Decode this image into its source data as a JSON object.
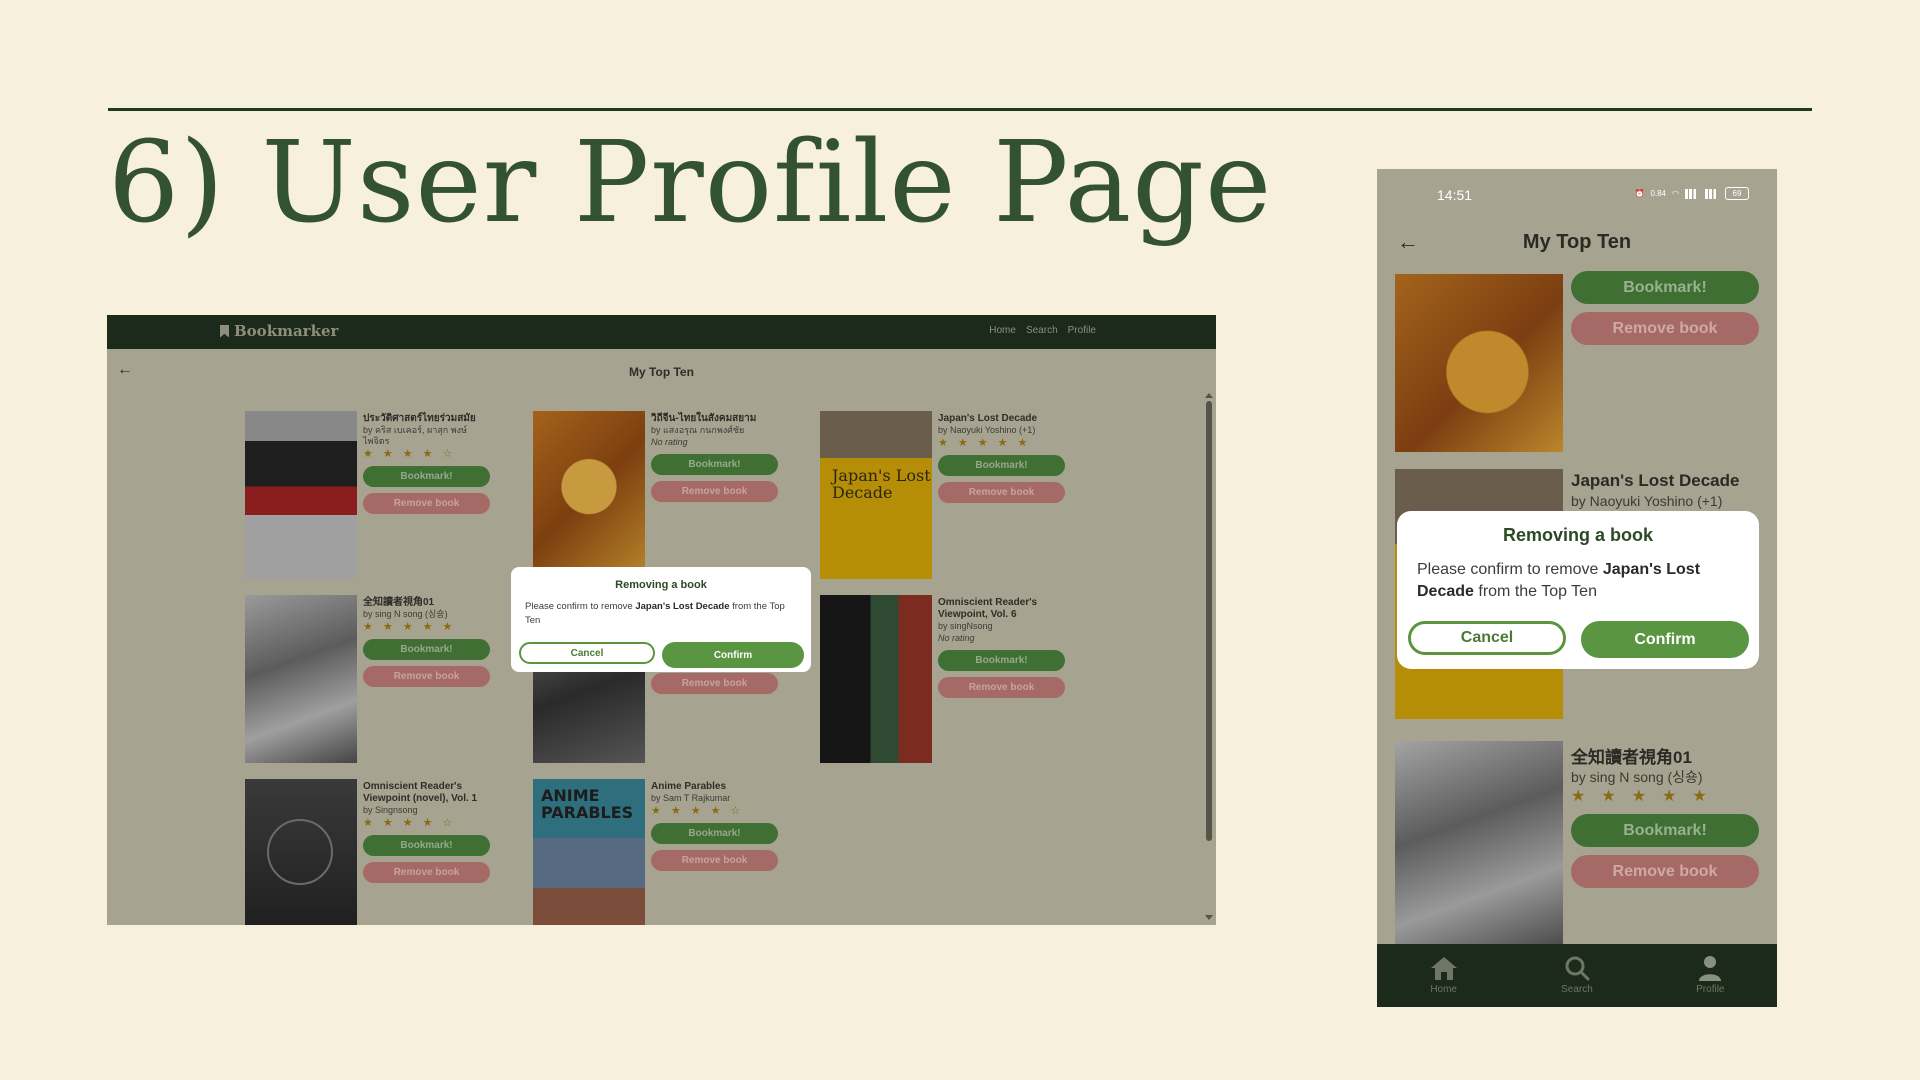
{
  "slide": {
    "title": "6) User Profile Page"
  },
  "desktop": {
    "brand": "Bookmarker",
    "nav": [
      "Home",
      "Search",
      "Profile"
    ],
    "heading": "My Top Ten",
    "books": [
      {
        "title": "ประวัติศาสตร์ไทยร่วมสมัย",
        "author": "by คริส เบเคอร์, ผาสุก พงษ์ไพจิตร",
        "rating_text": "",
        "stars": 5
      },
      {
        "title": "วิถีจีน-ไทยในสังคมสยาม",
        "author": "by แสงอรุณ กนกพงศ์ชัย",
        "rating_text": "No rating",
        "stars": 0
      },
      {
        "title": "Japan's Lost Decade",
        "author": "by Naoyuki Yoshino (+1)",
        "rating_text": "",
        "stars": 5
      },
      {
        "title": "全知讀者視角01",
        "author": "by sing N song (싱숑)",
        "rating_text": "",
        "stars": 5
      },
      {
        "title": "",
        "author": "",
        "rating_text": "",
        "stars": 0
      },
      {
        "title": "Omniscient Reader's Viewpoint, Vol. 6",
        "author": "by singNsong",
        "rating_text": "No rating",
        "stars": 0
      },
      {
        "title": "Omniscient Reader's Viewpoint (novel), Vol. 1",
        "author": "by Singnsong",
        "rating_text": "",
        "stars": 5
      },
      {
        "title": "Anime Parables",
        "author": "by Sam T Rajkumar",
        "rating_text": "",
        "stars": 5
      }
    ],
    "cover_text": {
      "japan": "Japan's Lost Decade",
      "anime": "ANIME PARABLES"
    },
    "bookmark_label": "Bookmark!",
    "remove_label": "Remove book",
    "modal": {
      "title": "Removing a book",
      "body_prefix": "Please confirm to remove ",
      "book": "Japan's Lost Decade",
      "body_suffix": " from the Top Ten",
      "cancel": "Cancel",
      "confirm": "Confirm"
    }
  },
  "phone": {
    "time": "14:51",
    "status": {
      "speed": "0.84",
      "battery": "69"
    },
    "heading": "My Top Ten",
    "book2": {
      "title": "Japan's Lost Decade",
      "author": "by Naoyuki Yoshino (+1)"
    },
    "book3": {
      "title": "全知讀者視角01",
      "author": "by sing N song (싱숑)"
    },
    "bookmark_label": "Bookmark!",
    "remove_label": "Remove book",
    "modal": {
      "title": "Removing a book",
      "body_prefix": "Please confirm to remove ",
      "book": "Japan's Lost Decade",
      "body_suffix": " from the Top Ten",
      "cancel": "Cancel",
      "confirm": "Confirm"
    },
    "tabs": [
      {
        "label": "Home",
        "icon": "home-icon"
      },
      {
        "label": "Search",
        "icon": "search-icon"
      },
      {
        "label": "Profile",
        "icon": "profile-icon"
      }
    ]
  },
  "colors": {
    "background": "#f7f0dc",
    "title_green": "#335232",
    "nav_dark": "#1b2a1a",
    "bookmark_green": "#5a9542",
    "remove_red": "#c46b68"
  }
}
